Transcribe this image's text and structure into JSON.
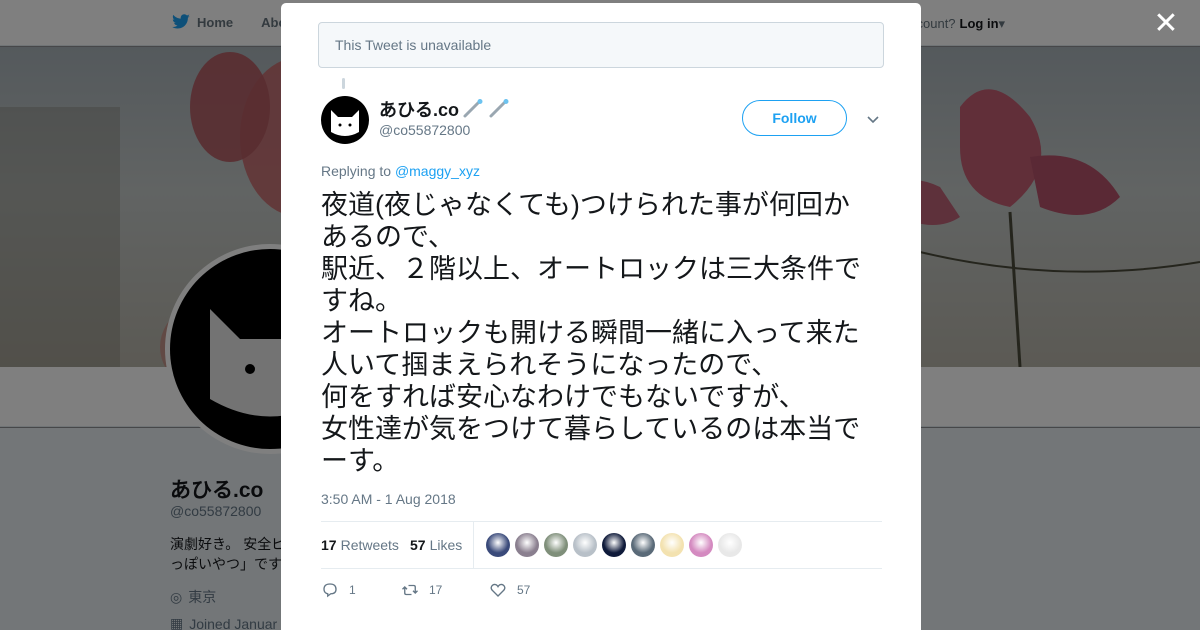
{
  "topbar": {
    "home_label": "Home",
    "about_label": "Abo",
    "login_prompt": "ccount?",
    "login_label": "Log in"
  },
  "background_profile": {
    "name": "あひる.co",
    "handle": "@co55872800",
    "bio_line1": "演劇好き。 安全ピ",
    "bio_line2": "っぽいやつ」です",
    "location": "東京",
    "joined": "Joined Januar"
  },
  "modal": {
    "unavailable_text": "This Tweet is unavailable",
    "author": {
      "name": "あひる.co",
      "handle": "@co55872800"
    },
    "follow_label": "Follow",
    "replying_prefix": "Replying to",
    "replying_handle": "@maggy_xyz",
    "text": "夜道(夜じゃなくても)つけられた事が何回か\nあるので、\n駅近、２階以上、オートロックは三大条件で\nすね。\nオートロックも開ける瞬間一緒に入って来た\n人いて掴まえられそうになったので、\n何をすれば安心なわけでもないですが、\n女性達が気をつけて暮らしているのは本当で\nーす。",
    "timestamp": "3:50 AM - 1 Aug 2018",
    "retweets_count": "17",
    "retweets_label": "Retweets",
    "likes_count": "57",
    "likes_label": "Likes",
    "likers": [
      "#3a4a7a",
      "#8a7f8f",
      "#7f8f7a",
      "#b8c0c8",
      "#0f1a3a",
      "#5a6a78",
      "#f3e2b0",
      "#d48ac0",
      "#e8e8e8"
    ],
    "actions": {
      "reply_count": "1",
      "retweet_count": "17",
      "like_count": "57"
    }
  },
  "colors": {
    "accent": "#1da1f2",
    "text": "#14171a",
    "muted": "#657786"
  }
}
